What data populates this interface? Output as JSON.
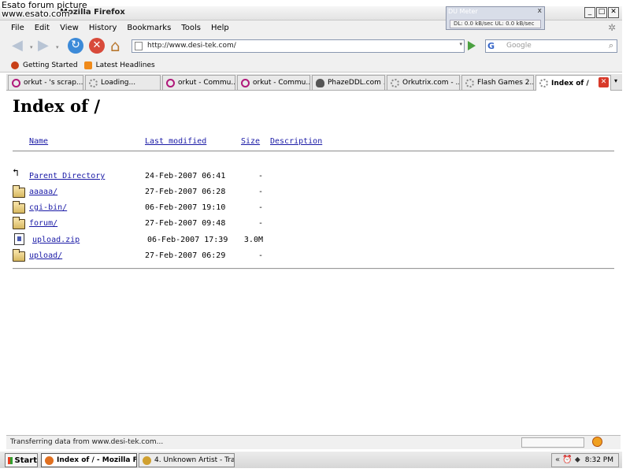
{
  "watermark": {
    "line1": "Esato forum picture",
    "line2": "www.esato.com"
  },
  "window": {
    "title": "Mozilla Firefox",
    "minimize": "_",
    "maximize": "□",
    "close": "✕"
  },
  "du_meter": {
    "title": "DU Meter",
    "close": "x",
    "rates": "DL: 0.0 kB/sec  UL: 0.0 kB/sec"
  },
  "menu": [
    "File",
    "Edit",
    "View",
    "History",
    "Bookmarks",
    "Tools",
    "Help"
  ],
  "toolbar": {
    "back_icon": "◀",
    "forward_icon": "▶",
    "dropdown_icon": "▾",
    "reload_icon": "↻",
    "stop_icon": "✕",
    "home_icon": "⌂",
    "throbber_icon": "✲"
  },
  "address": {
    "url": "http://www.desi-tek.com/",
    "dropdown_icon": "▾"
  },
  "search": {
    "engine_icon": "G",
    "placeholder": "Google",
    "search_icon": "⌕"
  },
  "bookmarks": [
    {
      "label": "Getting Started",
      "icon": "firefox-icon"
    },
    {
      "label": "Latest Headlines",
      "icon": "rss-icon"
    }
  ],
  "tabs": [
    {
      "label": "orkut - 's scrap...",
      "icon": "orkut-icon"
    },
    {
      "label": "Loading...",
      "icon": "loading-icon"
    },
    {
      "label": "orkut - Commu...",
      "icon": "orkut-icon"
    },
    {
      "label": "orkut - Commu...",
      "icon": "orkut-icon"
    },
    {
      "label": "PhazeDDL.com ...",
      "icon": "skull-icon"
    },
    {
      "label": "Orkutrix.com - ...",
      "icon": "loading-icon"
    },
    {
      "label": "Flash Games 2...",
      "icon": "loading-icon"
    },
    {
      "label": "Index of /",
      "icon": "loading-icon",
      "active": true
    }
  ],
  "tab_close": "✕",
  "tab_list": "▾",
  "page": {
    "title": "Index of /",
    "headers": {
      "name": "Name",
      "modified": "Last modified",
      "size": "Size",
      "description": "Description"
    },
    "entries": [
      {
        "name": "Parent Directory",
        "modified": "24-Feb-2007 06:41",
        "size": "-",
        "type": "parent"
      },
      {
        "name": "aaaaa/",
        "modified": "27-Feb-2007 06:28",
        "size": "-",
        "type": "folder"
      },
      {
        "name": "cgi-bin/",
        "modified": "06-Feb-2007 19:10",
        "size": "-",
        "type": "folder"
      },
      {
        "name": "forum/",
        "modified": "27-Feb-2007 09:48",
        "size": "-",
        "type": "folder"
      },
      {
        "name": "upload.zip",
        "modified": "06-Feb-2007 17:39",
        "size": "3.0M",
        "type": "file"
      },
      {
        "name": "upload/",
        "modified": "27-Feb-2007 06:29",
        "size": "-",
        "type": "folder"
      }
    ]
  },
  "status": {
    "text": "Transferring data from www.desi-tek.com..."
  },
  "taskbar": {
    "start": "Start",
    "tasks": [
      {
        "label": "Index of / - Mozilla Fir...",
        "active": true
      },
      {
        "label": "4. Unknown Artist - Trac...",
        "active": false
      }
    ],
    "tray_icons": "« ⏰ ⬥",
    "clock": "8:32 PM"
  }
}
